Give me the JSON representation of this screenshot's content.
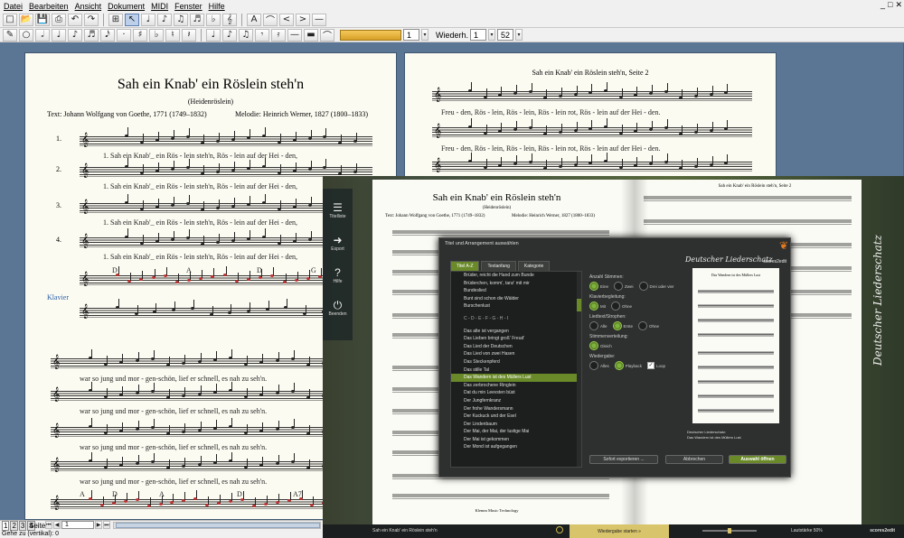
{
  "menu": [
    "Datei",
    "Bearbeiten",
    "Ansicht",
    "Dokument",
    "MIDI",
    "Fenster",
    "Hilfe"
  ],
  "toolbar": {
    "page_value": "1",
    "repeat_label": "Wiederh.",
    "repeat_value": "1",
    "zoom_value": "52",
    "tb1_icons": [
      "new-icon",
      "open-icon",
      "save-icon",
      "print-icon",
      "undo-icon",
      "redo-icon",
      "select-icon",
      "note-icon",
      "note2-icon",
      "note3-icon",
      "note4-icon",
      "note5-icon",
      "note6-icon",
      "text-icon",
      "slur-icon",
      "crescendo-icon",
      "decrescendo-icon",
      "line-icon",
      "wave-icon"
    ],
    "tb1_glyphs": [
      "□",
      "📂",
      "💾",
      "⎙",
      "↶",
      "↷",
      "⊞",
      "↖",
      "♩",
      "♪",
      "♫",
      "♬",
      "♭",
      "𝄞",
      "A",
      "⌒",
      "<",
      ">",
      "—",
      "≈"
    ],
    "tb2_glyphs": [
      "✎",
      "○",
      "𝅗𝅥",
      "♩",
      "♪",
      "♬",
      "𝅘𝅥𝅯",
      "·",
      "♯",
      "♭",
      "♮",
      "𝄽",
      "♩",
      "♪",
      "♫",
      "𝄾",
      "𝄿",
      "—",
      "▬",
      "⌒"
    ]
  },
  "score": {
    "title": "Sah ein Knab' ein Röslein steh'n",
    "subtitle": "(Heidenröslein)",
    "text_credit": "Text: Johann Wolfgang von Goethe, 1771 (1749–1832)",
    "melody_credit": "Melodie: Heinrich Werner, 1827 (1800–1833)",
    "staff_numbers": [
      "1.",
      "2.",
      "3.",
      "4."
    ],
    "lyric_line1": "1. Sah      ein Knab'_ ein Rös - lein steh'n,     Rös - lein auf   der Hei - den,",
    "klavier_label": "Klavier",
    "chords_line1": [
      "D",
      "A",
      "D",
      "G",
      "D"
    ],
    "lyric_line2": "war  so  jung  und mor - gen-schön,    lief   er  schnell,  es  nah  zu  seh'n.",
    "chords_line2": [
      "A",
      "D",
      "A",
      "D",
      "A7",
      "D"
    ],
    "page2_header": "Sah ein Knab' ein Röslein steh'n, Seite 2",
    "page2_lyric": "Freu - den,    Rös - lein, Rös - lein, Rös - lein rot,     Rös - lein auf   der Hei - den."
  },
  "overlay": {
    "sidebar": [
      {
        "icon": "list-icon",
        "glyph": "☰",
        "label": "Titelliste"
      },
      {
        "icon": "export-icon",
        "glyph": "➜",
        "label": "Export"
      },
      {
        "icon": "help-icon",
        "glyph": "?",
        "label": "Hilfe"
      },
      {
        "icon": "power-icon",
        "glyph": "⏻",
        "label": "Beenden"
      }
    ],
    "dialog_title": "Titel und Arrangement auswählen",
    "tabs": [
      "Titel A-Z",
      "Textanfang",
      "Kategorie"
    ],
    "songs": [
      "Brüder, reicht die Hand zum Bunde",
      "Brüderchen, komm', tanz' mit mir",
      "Bundeslied",
      "Bunt sind schon die Wälder",
      "Burschenlust",
      "",
      "C - D - E - F - G - H - I",
      "",
      "Das alte ist vergangen",
      "Das Lieben bringt groß' Freud'",
      "Das Lied der Deutschen",
      "Das Lied von zwei Hasen",
      "Das Steckenpferd",
      "Das stille Tal",
      "Das Wandern ist des Müllers Lust",
      "Das zerbrochene Ringlein",
      "Dat du min Leevsten büst",
      "Der Jungfernkranz",
      "Der frohe Wandersmann",
      "Der Kuckuck und der Esel",
      "Der Lindenbaum",
      "Der Mai, der Mai, der lustige Mai",
      "Der Mai ist gekommen",
      "Der Mond ist aufgegangen"
    ],
    "selected_index": 14,
    "opt_voices_h": "Anzahl Stimmen:",
    "opt_voices": [
      "Eine",
      "Zwei",
      "Drei oder vier"
    ],
    "opt_piano_h": "Klavierbegleitung:",
    "opt_piano": [
      "Mit",
      "Ohne"
    ],
    "opt_lyrics_h": "Liedtext/Strophen:",
    "opt_lyrics": [
      "Alle",
      "Erste",
      "Ohne"
    ],
    "opt_dist_h": "Stimmenverteilung:",
    "opt_dist": [
      "Gleich"
    ],
    "opt_play_h": "Wiedergabe:",
    "opt_play": [
      "Alles",
      "Playback",
      "Loop"
    ],
    "brand": "Deutscher Liederschatz",
    "brand2": "scores2edit",
    "preview_title": "Das Wandern ist des Müllers Lust",
    "preview_caption1": "Deutscher Liederschatz:",
    "preview_caption2": "Das Wandern ist des Müllers Lust",
    "btn_export": "Sofort exportieren ...",
    "btn_cancel": "Abbrechen",
    "btn_open": "Auswahl öffnen",
    "bottom_title": "Sah ein Knab' ein Röslein steh'n",
    "bottom_play": "Wiedergabe starten »",
    "bottom_speed": "Lautstärke 50%",
    "bottom_brand": "scores2edit",
    "vertical_title": "Deutscher Liederschatz",
    "book_footer": "Klemm Music Technology"
  },
  "status": {
    "seite_label": "Seite:",
    "seite_value": "1",
    "tabs": [
      "1",
      "2",
      "3",
      "4"
    ],
    "bottom_text": "Gehe zu (vertikal): 0"
  }
}
